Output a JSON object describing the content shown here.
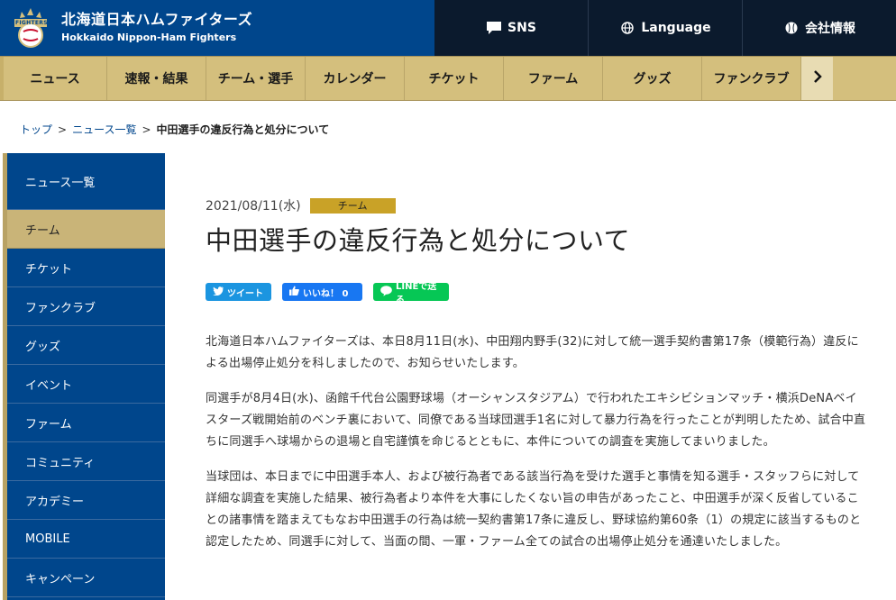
{
  "header": {
    "brand_jp": "北海道日本ハムファイターズ",
    "brand_en": "Hokkaido Nippon-Ham Fighters",
    "logo_text": "FIGHTERS",
    "util": [
      {
        "label": "SNS",
        "icon": "chat-bubble-icon"
      },
      {
        "label": "Language",
        "icon": "globe-icon"
      },
      {
        "label": "会社情報",
        "icon": "baseball-icon"
      }
    ]
  },
  "nav": {
    "items": [
      "ニュース",
      "速報・結果",
      "チーム・選手",
      "カレンダー",
      "チケット",
      "ファーム",
      "グッズ",
      "ファンクラブ"
    ],
    "more_icon": "chevron-right-icon"
  },
  "breadcrumb": {
    "home": "トップ",
    "list": "ニュース一覧",
    "current": "中田選手の違反行為と処分について",
    "sep": ">"
  },
  "sidebar": {
    "head": "ニュース一覧",
    "items": [
      "チーム",
      "チケット",
      "ファンクラブ",
      "グッズ",
      "イベント",
      "ファーム",
      "コミュニティ",
      "アカデミー",
      "MOBILE",
      "キャンペーン"
    ],
    "active_index": 0
  },
  "article": {
    "date": "2021/08/11(水)",
    "category": "チーム",
    "title": "中田選手の違反行為と処分について",
    "share": {
      "tweet": "ツイート",
      "like": "いいね！ 0",
      "line": "LINEで送る"
    },
    "paragraphs": [
      "北海道日本ハムファイターズは、本日8月11日(水)、中田翔内野手(32)に対して統一選手契約書第17条（模範行為）違反による出場停止処分を科しましたので、お知らせいたします。",
      "同選手が8月4日(水)、函館千代台公園野球場（オーシャンスタジアム）で行われたエキシビションマッチ・横浜DeNAベイスターズ戦開始前のベンチ裏において、同僚である当球団選手1名に対して暴力行為を行ったことが判明したため、試合中直ちに同選手へ球場からの退場と自宅謹慎を命じるとともに、本件についての調査を実施してまいりました。",
      "当球団は、本日までに中田選手本人、および被行為者である該当行為を受けた選手と事情を知る選手・スタッフらに対して詳細な調査を実施した結果、被行為者より本件を大事にしたくない旨の申告があったこと、中田選手が深く反省していることの諸事情を踏まえてもなお中田選手の行為は統一契約書第17条に違反し、野球協約第60条（1）の規定に該当するものと認定したため、同選手に対して、当面の間、一軍・ファーム全ての試合の出場停止処分を通達いたしました。"
    ]
  },
  "colors": {
    "brand_blue": "#00468c",
    "util_dark": "#0b1a2d",
    "gold": "#d4bf7d",
    "category_gold": "#c9a227"
  }
}
